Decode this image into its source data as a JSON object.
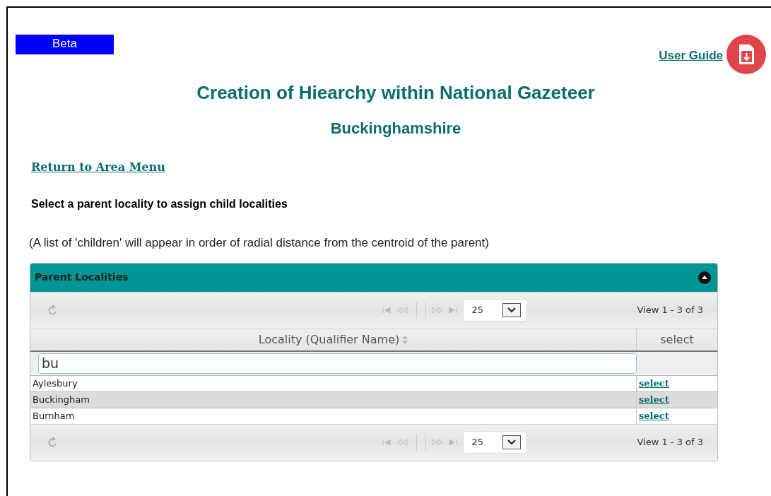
{
  "badge": "Beta",
  "user_guide": {
    "label": "User Guide"
  },
  "title": "Creation of Hiearchy within National Gazeteer",
  "subtitle": "Buckinghamshire",
  "return_link": "Return to Area Menu",
  "instruction": "Select a parent locality to assign child localities",
  "note": "(A list of 'children' will appear in order of radial distance from the centroid of the parent)",
  "grid": {
    "title": "Parent Localities",
    "expanded": true,
    "top_pager": {
      "page_size": "25",
      "view": "View 1 - 3 of 3"
    },
    "columns": [
      {
        "label": "Locality (Qualifier Name)",
        "sortable": true
      },
      {
        "label": "select",
        "sortable": false
      }
    ],
    "filter": {
      "value": "bu"
    },
    "rows": [
      {
        "locality": "Aylesbury",
        "action": "select",
        "selected": false
      },
      {
        "locality": "Buckingham",
        "action": "select",
        "selected": true
      },
      {
        "locality": "Burnham",
        "action": "select",
        "selected": false
      }
    ],
    "bottom_pager": {
      "page_size": "25",
      "view": "View 1 - 3 of 3"
    }
  }
}
